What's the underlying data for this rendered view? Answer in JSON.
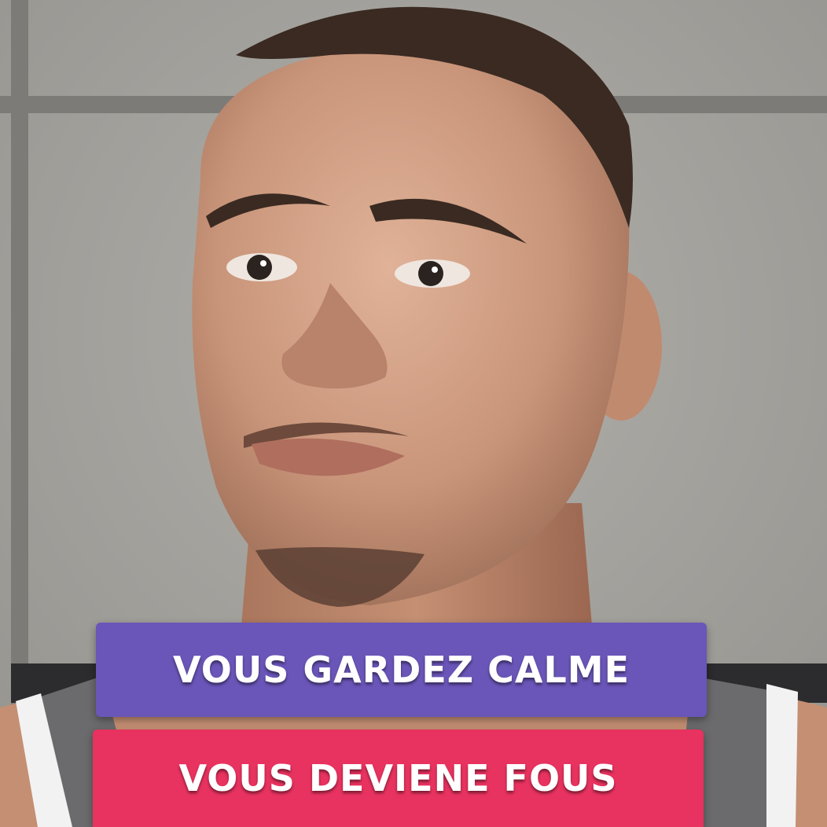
{
  "choices": [
    {
      "label": "VOUS GARDEZ CALME",
      "color": "#6a55b8"
    },
    {
      "label": "VOUS DEVIENE FOUS",
      "color": "#e8325f"
    }
  ],
  "colors": {
    "wall": "#a3a19c",
    "wall_grout": "#7d7b77",
    "skin": "#c9957a",
    "hair": "#3a2a22",
    "tank_top": "#6b6a6c"
  }
}
